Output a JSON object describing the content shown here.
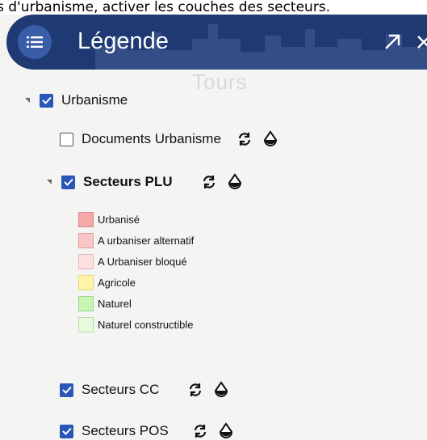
{
  "caption": "s d'urbanisme, activer les couches des secteurs.",
  "header": {
    "title": "Légende",
    "map_label": "Tours"
  },
  "layers": {
    "urbanisme": {
      "label": "Urbanisme",
      "checked": true
    },
    "documents": {
      "label": "Documents Urbanisme",
      "checked": false
    },
    "secteurs_plu": {
      "label": "Secteurs PLU",
      "checked": true
    },
    "secteurs_cc": {
      "label": "Secteurs CC",
      "checked": true
    },
    "secteurs_pos": {
      "label": "Secteurs POS",
      "checked": true
    }
  },
  "plu_legend": [
    {
      "label": "Urbanisé",
      "color": "#f4a8a8",
      "border": "#d98a8a"
    },
    {
      "label": "A urbaniser alternatif",
      "color": "#f9c6c6",
      "border": "#e09c9c"
    },
    {
      "label": "A Urbaniser bloqué",
      "color": "#fde0e0",
      "border": "#e8b6b6"
    },
    {
      "label": "Agricole",
      "color": "#fff4a8",
      "border": "#e6d884"
    },
    {
      "label": "Naturel",
      "color": "#c8f5b4",
      "border": "#9ed68a"
    },
    {
      "label": "Naturel constructible",
      "color": "#e6fadc",
      "border": "#b7dca6"
    }
  ],
  "colors": {
    "header_bg": "#1f3a73",
    "checkbox": "#2a56b8"
  }
}
